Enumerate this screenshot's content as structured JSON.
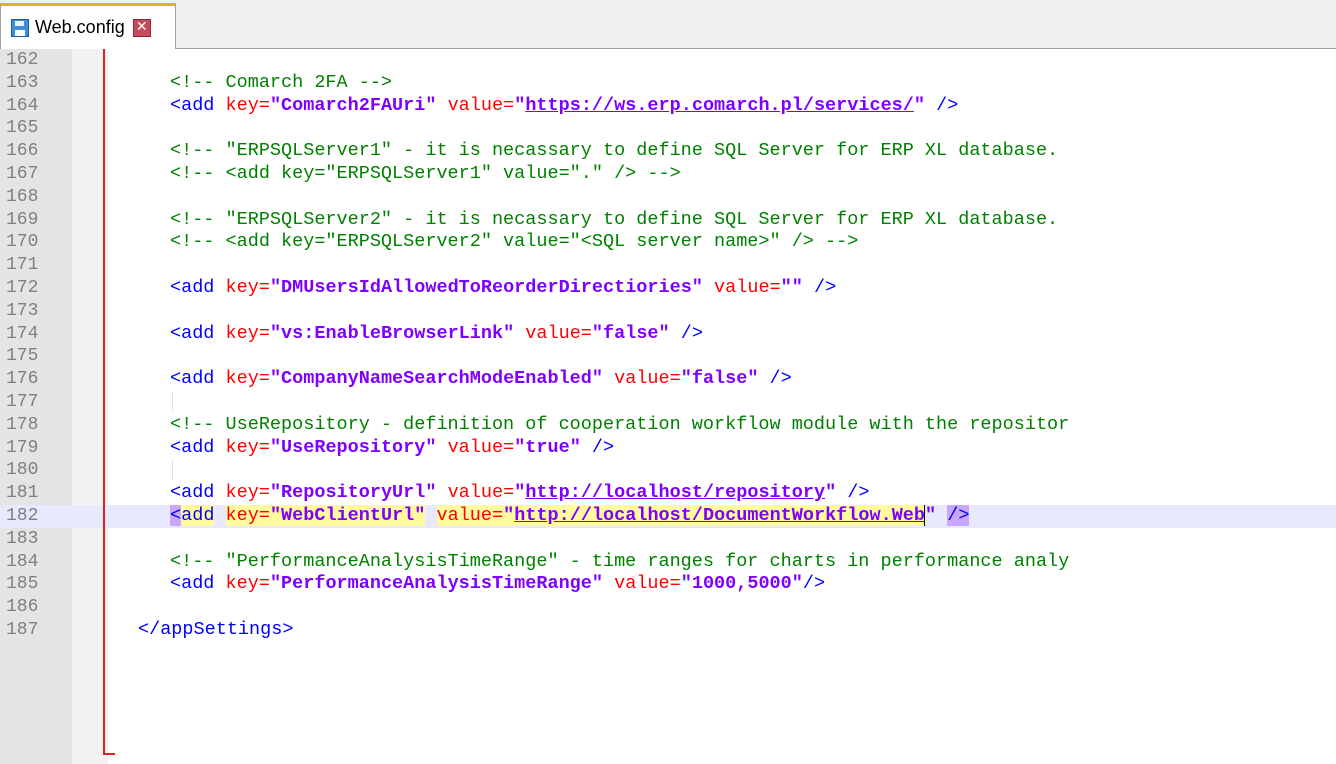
{
  "tab": {
    "filename": "Web.config",
    "icon": "save-icon",
    "close_icon": "close-icon"
  },
  "editor": {
    "current_line": 182,
    "lines": [
      {
        "n": "162",
        "segments": []
      },
      {
        "n": "163",
        "segments": [
          {
            "t": "cm",
            "v": "<!-- Comarch 2FA -->"
          }
        ]
      },
      {
        "n": "164",
        "segments": [
          {
            "t": "tg",
            "v": "<add "
          },
          {
            "t": "at",
            "v": "key="
          },
          {
            "t": "av",
            "v": "\"Comarch2FAUri\""
          },
          {
            "t": "tg",
            "v": " "
          },
          {
            "t": "at",
            "v": "value="
          },
          {
            "t": "qt",
            "v": "\""
          },
          {
            "t": "avu",
            "v": "https://ws.erp.comarch.pl/services/"
          },
          {
            "t": "qt",
            "v": "\""
          },
          {
            "t": "tg",
            "v": " />"
          }
        ]
      },
      {
        "n": "165",
        "segments": []
      },
      {
        "n": "166",
        "segments": [
          {
            "t": "cm",
            "v": "<!-- \"ERPSQLServer1\" - it is necassary to define SQL Server for ERP XL database."
          }
        ]
      },
      {
        "n": "167",
        "segments": [
          {
            "t": "cm",
            "v": "<!-- <add key=\"ERPSQLServer1\" value=\".\" /> -->"
          }
        ]
      },
      {
        "n": "168",
        "segments": []
      },
      {
        "n": "169",
        "segments": [
          {
            "t": "cm",
            "v": "<!-- \"ERPSQLServer2\" - it is necassary to define SQL Server for ERP XL database."
          }
        ]
      },
      {
        "n": "170",
        "segments": [
          {
            "t": "cm",
            "v": "<!-- <add key=\"ERPSQLServer2\" value=\"<SQL server name>\" /> -->"
          }
        ]
      },
      {
        "n": "171",
        "segments": []
      },
      {
        "n": "172",
        "segments": [
          {
            "t": "tg",
            "v": "<add "
          },
          {
            "t": "at",
            "v": "key="
          },
          {
            "t": "av",
            "v": "\"DMUsersIdAllowedToReorderDirectiories\""
          },
          {
            "t": "tg",
            "v": " "
          },
          {
            "t": "at",
            "v": "value="
          },
          {
            "t": "av",
            "v": "\"\""
          },
          {
            "t": "tg",
            "v": " />"
          }
        ]
      },
      {
        "n": "173",
        "segments": []
      },
      {
        "n": "174",
        "segments": [
          {
            "t": "tg",
            "v": "<add "
          },
          {
            "t": "at",
            "v": "key="
          },
          {
            "t": "av",
            "v": "\"vs:EnableBrowserLink\""
          },
          {
            "t": "tg",
            "v": " "
          },
          {
            "t": "at",
            "v": "value="
          },
          {
            "t": "av",
            "v": "\"false\""
          },
          {
            "t": "tg",
            "v": " />"
          }
        ]
      },
      {
        "n": "175",
        "segments": []
      },
      {
        "n": "176",
        "segments": [
          {
            "t": "tg",
            "v": "<add "
          },
          {
            "t": "at",
            "v": "key="
          },
          {
            "t": "av",
            "v": "\"CompanyNameSearchModeEnabled\""
          },
          {
            "t": "tg",
            "v": " "
          },
          {
            "t": "at",
            "v": "value="
          },
          {
            "t": "av",
            "v": "\"false\""
          },
          {
            "t": "tg",
            "v": " />"
          }
        ]
      },
      {
        "n": "177",
        "segments": [],
        "guide": true
      },
      {
        "n": "178",
        "segments": [
          {
            "t": "cm",
            "v": "<!-- UseRepository - definition of cooperation workflow module with the repositor"
          }
        ]
      },
      {
        "n": "179",
        "segments": [
          {
            "t": "tg",
            "v": "<add "
          },
          {
            "t": "at",
            "v": "key="
          },
          {
            "t": "av",
            "v": "\"UseRepository\""
          },
          {
            "t": "tg",
            "v": " "
          },
          {
            "t": "at",
            "v": "value="
          },
          {
            "t": "av",
            "v": "\"true\""
          },
          {
            "t": "tg",
            "v": " />"
          }
        ]
      },
      {
        "n": "180",
        "segments": [],
        "guide": true
      },
      {
        "n": "181",
        "segments": [
          {
            "t": "tg",
            "v": "<add "
          },
          {
            "t": "at",
            "v": "key="
          },
          {
            "t": "av",
            "v": "\"RepositoryUrl\""
          },
          {
            "t": "tg",
            "v": " "
          },
          {
            "t": "at",
            "v": "value="
          },
          {
            "t": "qt",
            "v": "\""
          },
          {
            "t": "avu",
            "v": "http://localhost/repository"
          },
          {
            "t": "qt",
            "v": "\""
          },
          {
            "t": "tg",
            "v": " />"
          }
        ]
      },
      {
        "n": "182",
        "segments": [
          {
            "t": "tg hlbr",
            "v": "<"
          },
          {
            "t": "tg hl",
            "v": "add"
          },
          {
            "t": "tg",
            "v": " "
          },
          {
            "t": "at hl",
            "v": "key="
          },
          {
            "t": "av hl",
            "v": "\"WebClientUrl\""
          },
          {
            "t": "tg",
            "v": " "
          },
          {
            "t": "at hl",
            "v": "value="
          },
          {
            "t": "qt hl",
            "v": "\""
          },
          {
            "t": "avu hl",
            "v": "http://localhost/DocumentWorkflow.Web"
          },
          {
            "t": "qt caret",
            "v": "\""
          },
          {
            "t": "tg",
            "v": " "
          },
          {
            "t": "tg hlbr",
            "v": "/>"
          }
        ]
      },
      {
        "n": "183",
        "segments": []
      },
      {
        "n": "184",
        "segments": [
          {
            "t": "cm",
            "v": "<!-- \"PerformanceAnalysisTimeRange\" - time ranges for charts in performance analy"
          }
        ]
      },
      {
        "n": "185",
        "segments": [
          {
            "t": "tg",
            "v": "<add "
          },
          {
            "t": "at",
            "v": "key="
          },
          {
            "t": "av",
            "v": "\"PerformanceAnalysisTimeRange\""
          },
          {
            "t": "tg",
            "v": " "
          },
          {
            "t": "at",
            "v": "value="
          },
          {
            "t": "av",
            "v": "\"1000,5000\""
          },
          {
            "t": "tg",
            "v": "/>"
          }
        ]
      },
      {
        "n": "186",
        "segments": []
      },
      {
        "n": "187",
        "segments": [
          {
            "t": "tg",
            "v": "</appSettings>"
          }
        ],
        "outdent": true
      }
    ]
  }
}
